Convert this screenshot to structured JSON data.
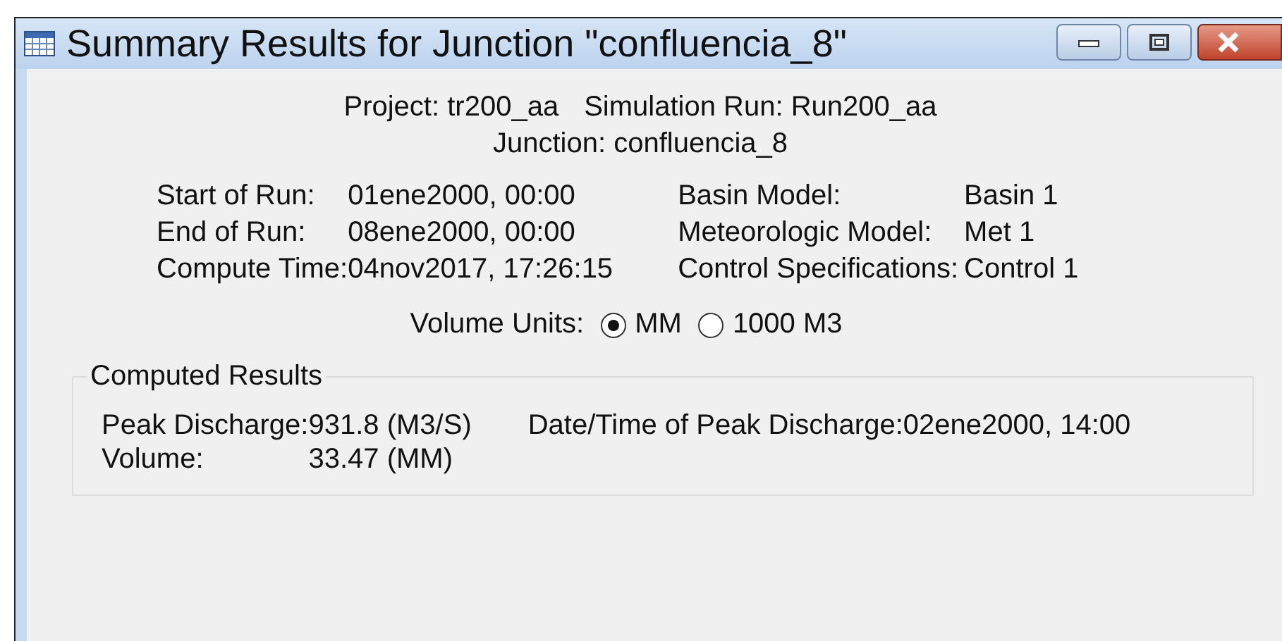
{
  "window": {
    "title": "Summary Results for Junction \"confluencia_8\""
  },
  "header": {
    "project": {
      "label": "Project:",
      "value": "tr200_aa"
    },
    "simulation_run": {
      "label": "Simulation Run:",
      "value": "Run200_aa"
    },
    "junction": {
      "label": "Junction:",
      "value": "confluencia_8"
    }
  },
  "run_info": [
    {
      "label": "Start of Run:",
      "value": "01ene2000, 00:00"
    },
    {
      "label": "End of Run:",
      "value": "08ene2000, 00:00"
    },
    {
      "label": "Compute Time:",
      "value": "04nov2017, 17:26:15"
    }
  ],
  "model_info": [
    {
      "label": "Basin Model:",
      "value": "Basin 1"
    },
    {
      "label": "Meteorologic Model:",
      "value": "Met 1"
    },
    {
      "label": "Control Specifications:",
      "value": "Control 1"
    }
  ],
  "volume_units": {
    "label": "Volume Units:",
    "options": [
      {
        "label": "MM",
        "selected": true
      },
      {
        "label": "1000 M3",
        "selected": false
      }
    ]
  },
  "computed_results": {
    "title": "Computed Results",
    "items": [
      {
        "label": "Peak Discharge:",
        "value": "931.8 (M3/S)"
      },
      {
        "label": "Volume:",
        "value": "33.47 (MM)"
      }
    ],
    "peak_time": {
      "label": "Date/Time of Peak Discharge:",
      "value": "02ene2000, 14:00"
    }
  }
}
